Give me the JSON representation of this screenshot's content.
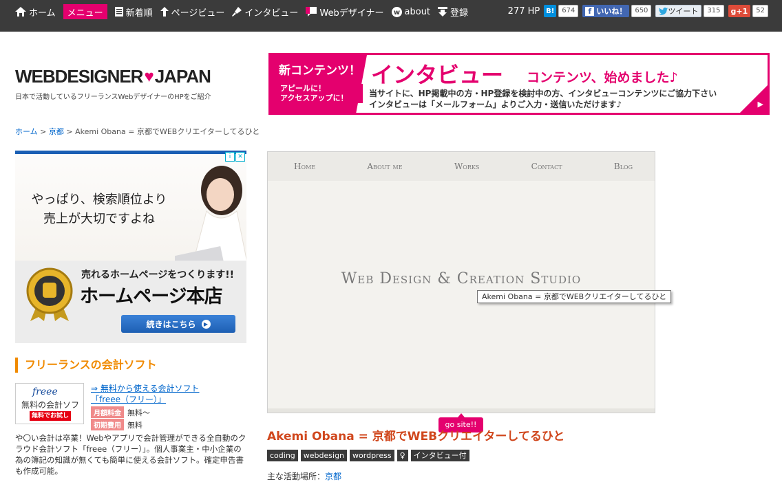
{
  "nav": {
    "items": [
      {
        "label": "ホーム",
        "icon": "home-icon"
      },
      {
        "label": "メニュー",
        "icon": "",
        "active": true
      },
      {
        "label": "新着順",
        "icon": "document-icon"
      },
      {
        "label": "ページビュー",
        "icon": "arrow-up-icon"
      },
      {
        "label": "インタビュー",
        "icon": "microphone-icon"
      },
      {
        "label": "Webデザイナー",
        "icon": "speech-bubble-icon"
      },
      {
        "label": "about",
        "icon": "w-circle-icon"
      },
      {
        "label": "登録",
        "icon": "download-icon"
      }
    ]
  },
  "social": {
    "hp_count": "277 HP",
    "hatena_label": "B!",
    "hatena_count": "674",
    "facebook_label": "いいね！",
    "facebook_count": "650",
    "twitter_label": "ツイート",
    "twitter_count": "315",
    "google_label": "g+1",
    "google_count": "52"
  },
  "header": {
    "logo_left": "WEBDESIGNER",
    "logo_heart": "♥",
    "logo_right": "JAPAN",
    "tagline": "日本で活動しているフリーランスWebデザイナーのHPをご紹介"
  },
  "banner": {
    "new_label": "新コンテンツ！",
    "appeal_line1": "アピールに！",
    "appeal_line2": "アクセスアップに！",
    "big_title": "インタビュー",
    "sub_title": "コンテンツ、始めました♪",
    "desc_line1": "当サイトに、HP掲載中の方・HP登録を検討中の方、インタビューコンテンツにご協力下さい",
    "desc_line2": "インタビューは「メールフォーム」よりご入力・送信いただけます♪",
    "arrow": "▶"
  },
  "breadcrumb": {
    "home": "ホーム",
    "sep1": " > ",
    "area": "京都",
    "sep2": " > ",
    "current": "Akemi Obana = 京都でWEBクリエイターしてるひと"
  },
  "ad": {
    "copy_line1": "やっぱり、検索順位より",
    "copy_line2": "売上が大切ですよね",
    "slogan": "売れるホームページをつくります!!",
    "shop_name": "ホームページ本店",
    "cta": "続きはこちら",
    "cta_icon": "▶",
    "adchoice_i": "i",
    "adchoice_x": "✕"
  },
  "sidebar": {
    "heading": "フリーランスの会計ソフト",
    "logo_text": "freee",
    "logo_caption": "無料の会計ソフト",
    "logo_badge": "無料でお試し",
    "link_line1": "⇒ 無料から使える会計ソフト",
    "link_line2": "「freee（フリー）」",
    "monthly_label": "月額料金",
    "monthly_value": "無料～",
    "initial_label": "初期費用",
    "initial_value": "無料",
    "description": "や〇い会計は卒業！Webやアプリで会計管理ができる全自動のクラウド会計ソフト「freee（フリー）」。個人事業主・中小企業の為の簿記の知識が無くても簡単に使える会計ソフト。確定申告書も作成可能。"
  },
  "screenshot": {
    "nav": [
      "Home",
      "About me",
      "Works",
      "Contact",
      "Blog"
    ],
    "studio_title": "Web Design & Creation Studio"
  },
  "tooltip": "Akemi Obana = 京都でWEBクリエイターしてるひと",
  "go_site": "go site!!",
  "post": {
    "title": "Akemi Obana = 京都でWEBクリエイターしてるひと",
    "tags": [
      "coding",
      "webdesign",
      "wordpress",
      "♀",
      "インタビュー付"
    ],
    "area_label": "主な活動場所：",
    "area_value": "京都"
  },
  "colors": {
    "accent": "#e4006e",
    "topbar": "#3b3b3b",
    "title": "#d0471d",
    "sidebar_heading": "#f08a00"
  }
}
